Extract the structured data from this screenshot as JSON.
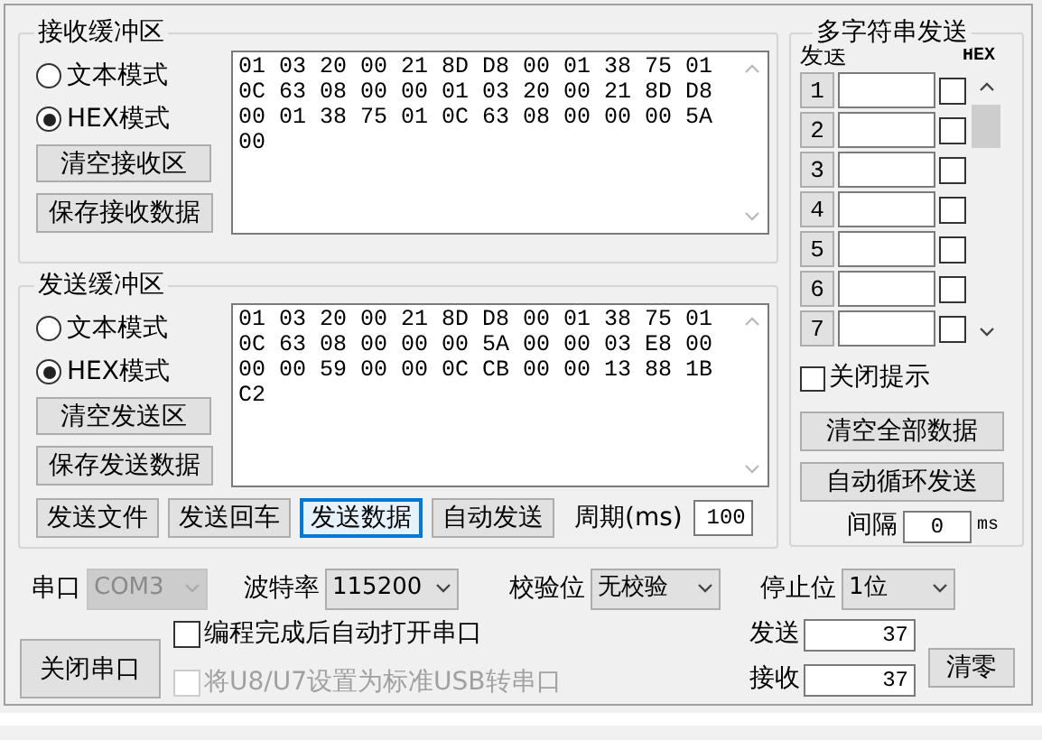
{
  "receive": {
    "title": "接收缓冲区",
    "modes": [
      {
        "label": "文本模式",
        "selected": false
      },
      {
        "label": "HEX模式",
        "selected": true
      }
    ],
    "buttons": [
      "清空接收区",
      "保存接收数据"
    ],
    "lines": [
      "01 03 20 00 21 8D D8 00 01 38 75 01",
      "0C 63 08 00 00 01 03 20 00 21 8D D8",
      "00 01 38 75 01 0C 63 08 00 00 00 5A",
      "00"
    ]
  },
  "send": {
    "title": "发送缓冲区",
    "modes": [
      {
        "label": "文本模式",
        "selected": false
      },
      {
        "label": "HEX模式",
        "selected": true
      }
    ],
    "buttons": [
      "清空发送区",
      "保存发送数据"
    ],
    "lines": [
      "01 03 20 00 21 8D D8 00 01 38 75 01",
      "0C 63 08 00 00 00 5A 00 00 03 E8 00",
      "00 00 59 00 00 0C CB 00 00 13 88 1B",
      "C2"
    ],
    "actions": [
      {
        "label": "发送文件",
        "focused": false
      },
      {
        "label": "发送回车",
        "focused": false
      },
      {
        "label": "发送数据",
        "focused": true
      },
      {
        "label": "自动发送",
        "focused": false
      }
    ],
    "period_label": "周期(ms)",
    "period": "100"
  },
  "multi": {
    "title": "多字符串发送",
    "send_header": "发送",
    "hex_header": "HEX",
    "rows": [
      {
        "number": "1",
        "hex": false
      },
      {
        "number": "2",
        "hex": false
      },
      {
        "number": "3",
        "hex": false
      },
      {
        "number": "4",
        "hex": false
      },
      {
        "number": "5",
        "hex": false
      },
      {
        "number": "6",
        "hex": false
      },
      {
        "number": "7",
        "hex": false
      }
    ],
    "close_tips": {
      "label": "关闭提示",
      "checked": false
    },
    "buttons": [
      "清空全部数据",
      "自动循环发送"
    ],
    "interval_label": "间隔",
    "interval": "0",
    "interval_unit": "ms"
  },
  "settings": [
    {
      "label": "串口",
      "value": "COM3",
      "disabled": true
    },
    {
      "label": "波特率",
      "value": "115200",
      "disabled": false
    },
    {
      "label": "校验位",
      "value": "无校验",
      "disabled": false
    },
    {
      "label": "停止位",
      "value": "1位",
      "disabled": false
    }
  ],
  "close_port": "关闭串口",
  "options": [
    {
      "label": "编程完成后自动打开串口",
      "checked": false,
      "disabled": false
    },
    {
      "label": "将U8/U7设置为标准USB转串口",
      "checked": false,
      "disabled": true
    }
  ],
  "counters": [
    {
      "label": "发送",
      "value": "37"
    },
    {
      "label": "接收",
      "value": "37"
    }
  ],
  "clear": "清零"
}
